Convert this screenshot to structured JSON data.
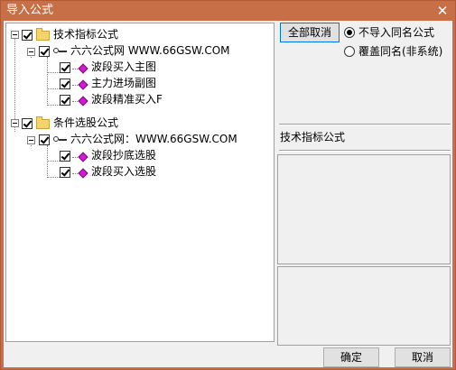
{
  "window": {
    "title": "导入公式",
    "close_glyph": "✕"
  },
  "tree": {
    "groups": [
      {
        "label": "技术指标公式",
        "source": "六六公式网 WWW.66GSW.COM",
        "items": [
          "波段买入主图",
          "主力进场副图",
          "波段精准买入F"
        ]
      },
      {
        "label": "条件选股公式",
        "source": "六六公式网：WWW.66GSW.COM",
        "items": [
          "波段抄底选股",
          "波段买入选股"
        ]
      }
    ]
  },
  "buttons": {
    "cancel_all": "全部取消",
    "ok": "确定",
    "cancel": "取消"
  },
  "options": {
    "no_import_same_name": "不导入同名公式",
    "overwrite_same_name": "覆盖同名(非系统)",
    "selected": "no_import_same_name"
  },
  "detail": {
    "title": "技术指标公式"
  },
  "colors": {
    "titlebar": "#c76f47",
    "client": "#f0f0f0",
    "item_icon": "#d11ad1"
  }
}
